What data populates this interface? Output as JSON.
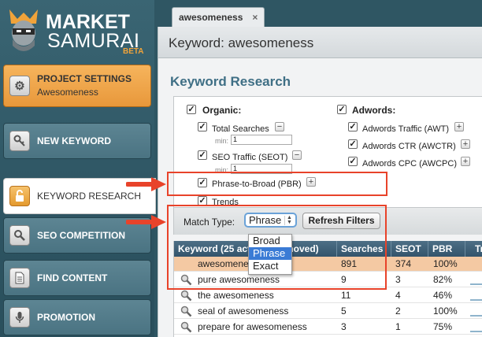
{
  "logo": {
    "line1": "MARKET",
    "line2": "SAMURAI",
    "badge": "BETA"
  },
  "sidebar": {
    "project": {
      "label": "PROJECT SETTINGS",
      "sub": "Awesomeness"
    },
    "items": [
      {
        "label": "NEW KEYWORD",
        "icon": "key-icon"
      },
      {
        "label": "KEYWORD RESEARCH",
        "icon": "lock-icon"
      },
      {
        "label": "SEO COMPETITION",
        "icon": "magnifier-icon"
      },
      {
        "label": "FIND CONTENT",
        "icon": "document-icon"
      },
      {
        "label": "PROMOTION",
        "icon": "microphone-icon"
      }
    ]
  },
  "tab": {
    "label": "awesomeness",
    "close": "×"
  },
  "header": {
    "title": "Keyword: awesomeness"
  },
  "section_title": "Keyword Research",
  "filters": {
    "organic": "Organic:",
    "total_searches": "Total Searches",
    "seo_traffic": "SEO Traffic (SEOT)",
    "min_label": "min:",
    "min_value": "1",
    "pbr": "Phrase-to-Broad (PBR)",
    "trends": "Trends",
    "adwords": "Adwords:",
    "awt": "Adwords Traffic (AWT)",
    "awctr": "Adwords CTR (AWCTR)",
    "awcpc": "Adwords CPC (AWCPC)",
    "check": "✓",
    "minus": "−",
    "plus": "+"
  },
  "match": {
    "label": "Match Type:",
    "selected": "Phrase",
    "options": [
      "Broad",
      "Phrase",
      "Exact"
    ],
    "refresh": "Refresh Filters"
  },
  "table": {
    "headers": [
      "Keyword (25 act",
      "moved)",
      "Searches",
      "SEOT",
      "PBR",
      "Tr"
    ],
    "rows": [
      {
        "keyword": "awesomene",
        "searches": "891",
        "seot": "374",
        "pbr": "100%"
      },
      {
        "keyword": "pure awesomeness",
        "searches": "9",
        "seot": "3",
        "pbr": "82%"
      },
      {
        "keyword": "the awesomeness",
        "searches": "11",
        "seot": "4",
        "pbr": "46%"
      },
      {
        "keyword": "seal of awesomeness",
        "searches": "5",
        "seot": "2",
        "pbr": "100%"
      },
      {
        "keyword": "prepare for awesomeness",
        "searches": "3",
        "seot": "1",
        "pbr": "75%"
      }
    ]
  },
  "colors": {
    "accent_orange": "#f0a33a",
    "highlight_red": "#e8432a",
    "header_blue": "#3f6f85",
    "selection": "#3a7bd5"
  }
}
